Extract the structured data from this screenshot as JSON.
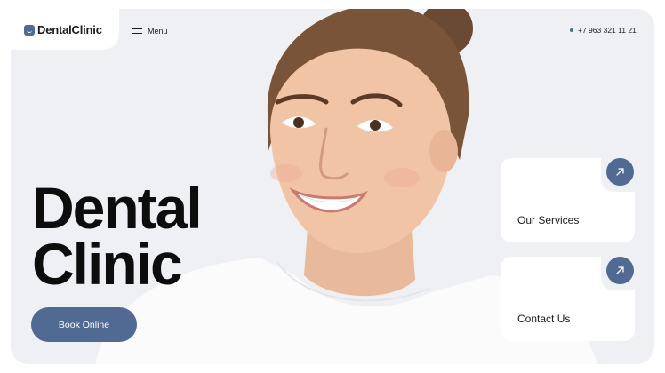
{
  "brand": {
    "name": "DentalClinic",
    "logo_icon": "tooth-logo-icon"
  },
  "nav": {
    "menu_label": "Menu",
    "menu_icon": "hamburger-icon"
  },
  "contact": {
    "phone": "+7 963 321 11 21"
  },
  "hero": {
    "title_line1": "Dental",
    "title_line2": "Clinic",
    "cta_label": "Book Online"
  },
  "cards": [
    {
      "label": "Our Services",
      "icon": "arrow-up-right-icon"
    },
    {
      "label": "Contact Us",
      "icon": "arrow-up-right-icon"
    }
  ],
  "colors": {
    "accent": "#506a94",
    "background": "#eef0f3",
    "text": "#0d0d0d"
  }
}
